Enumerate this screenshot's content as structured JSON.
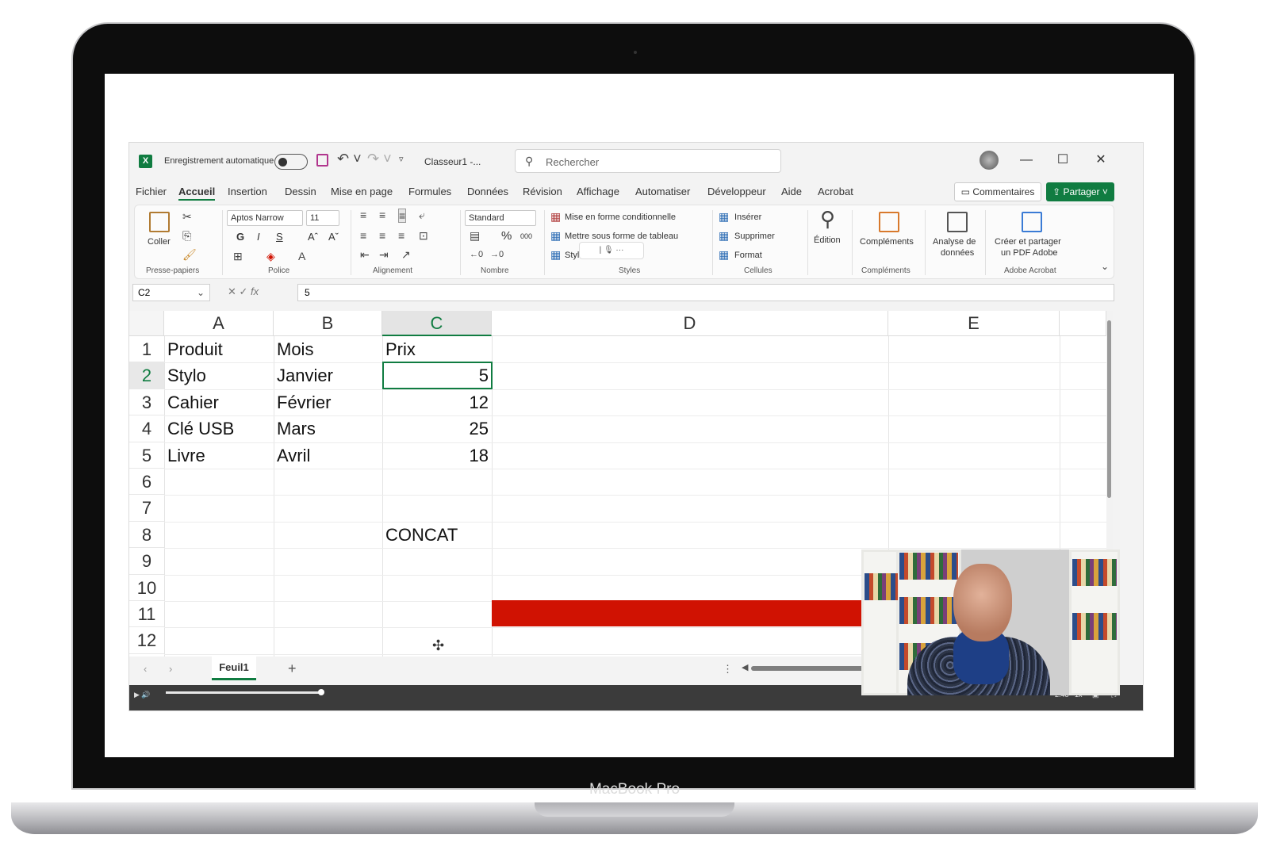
{
  "device": {
    "label": "MacBook Pro"
  },
  "titlebar": {
    "autosave_label": "Enregistrement automatique",
    "doc_title": "Classeur1  -...",
    "search_placeholder": "Rechercher"
  },
  "menu": {
    "items": [
      "Fichier",
      "Accueil",
      "Insertion",
      "Dessin",
      "Mise en page",
      "Formules",
      "Données",
      "Révision",
      "Affichage",
      "Automatiser",
      "Développeur",
      "Aide",
      "Acrobat"
    ],
    "active": "Accueil",
    "comments_label": "Commentaires",
    "share_label": "Partager"
  },
  "ribbon": {
    "clipboard": {
      "paste": "Coller",
      "group": "Presse-papiers"
    },
    "font": {
      "name": "Aptos Narrow",
      "size": "11",
      "bold": "G",
      "italic": "I",
      "underline": "S",
      "grow": "Aˆ",
      "shrink": "Aˇ",
      "group": "Police"
    },
    "alignment": {
      "group": "Alignement"
    },
    "number": {
      "format": "Standard",
      "percent": "%",
      "thousands": "000",
      "group": "Nombre"
    },
    "styles": {
      "conditional": "Mise en forme conditionnelle",
      "table": "Mettre sous forme de tableau",
      "cell_styles": "Styles de cellules",
      "group": "Styles"
    },
    "cells": {
      "insert": "Insérer",
      "delete": "Supprimer",
      "format": "Format",
      "group": "Cellules"
    },
    "editing": {
      "label": "Édition"
    },
    "addins": {
      "label": "Compléments",
      "group": "Compléments"
    },
    "analysis": {
      "label_line1": "Analyse de",
      "label_line2": "données"
    },
    "acrobat": {
      "label_line1": "Créer et partager",
      "label_line2": "un PDF Adobe",
      "group": "Adobe Acrobat"
    }
  },
  "formula_bar": {
    "name_box": "C2",
    "fx": "fx",
    "value": "5"
  },
  "sheet": {
    "columns": [
      "A",
      "B",
      "C",
      "D",
      "E"
    ],
    "selected_column": "C",
    "rows": [
      "1",
      "2",
      "3",
      "4",
      "5",
      "6",
      "7",
      "8",
      "9",
      "10",
      "11",
      "12"
    ],
    "selected_row": "2",
    "cells": {
      "A1": "Produit",
      "B1": "Mois",
      "C1": "Prix",
      "A2": "Stylo",
      "B2": "Janvier",
      "C2": "5",
      "A3": "Cahier",
      "B3": "Février",
      "C3": "12",
      "A4": "Clé USB",
      "B4": "Mars",
      "C4": "25",
      "A5": "Livre",
      "B5": "Avril",
      "C5": "18",
      "C8": "CONCAT"
    },
    "highlight_color": "#d01202"
  },
  "tabs": {
    "sheet_name": "Feuil1",
    "add_label": "+"
  },
  "player": {
    "speed": "1x",
    "time": "-2:48"
  },
  "colors": {
    "excel_green": "#107c41",
    "share_green": "#107c41"
  }
}
